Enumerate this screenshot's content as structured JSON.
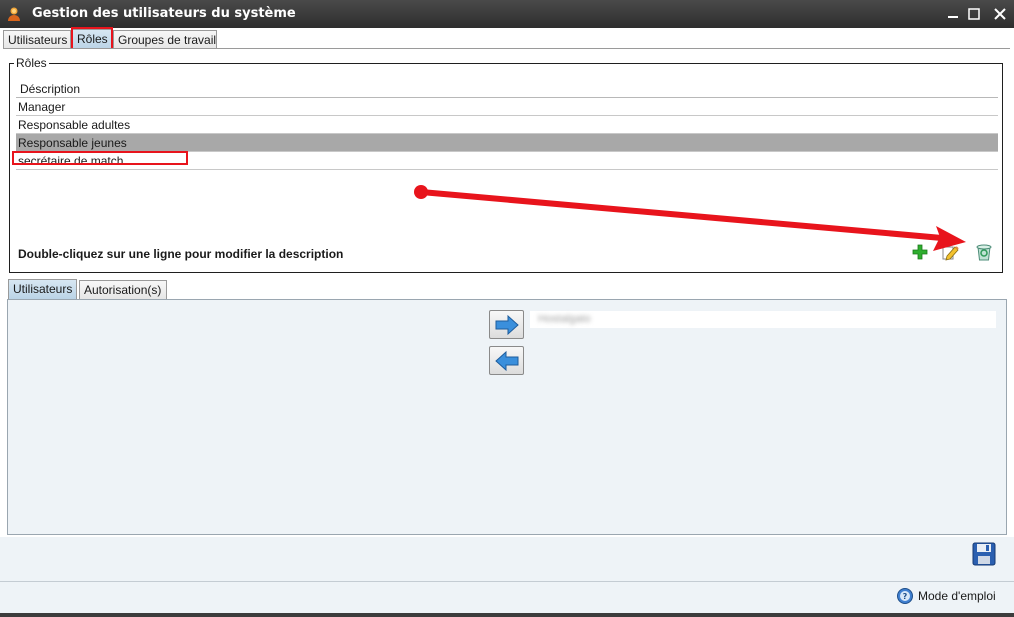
{
  "window": {
    "title": "Gestion des utilisateurs du système",
    "icon": "users-icon",
    "controls": [
      "minimize-icon",
      "maximize-icon",
      "close-icon"
    ]
  },
  "top_tabs": [
    {
      "label": "Utilisateurs",
      "active": false
    },
    {
      "label": "Rôles",
      "active": true
    },
    {
      "label": "Groupes de travail",
      "active": false
    }
  ],
  "roles": {
    "legend": "Rôles",
    "column_header": "Déscription",
    "rows": [
      {
        "label": "Manager",
        "selected": false
      },
      {
        "label": "Responsable adultes",
        "selected": false
      },
      {
        "label": "Responsable jeunes",
        "selected": true
      },
      {
        "label": "secrétaire de match",
        "selected": false
      }
    ],
    "hint": "Double-cliquez sur une ligne pour modifier la description",
    "actions": [
      "add-icon",
      "edit-icon",
      "delete-icon"
    ]
  },
  "bottom_tabs": [
    {
      "label": "Utilisateurs",
      "active": true
    },
    {
      "label": "Autorisation(s)",
      "active": false
    }
  ],
  "users_panel": {
    "buttons": [
      "arrow-right-icon",
      "arrow-left-icon"
    ],
    "assigned_users": [
      "Hostalgato"
    ]
  },
  "footer": {
    "save_icon": "save-icon",
    "help_label": "Mode d'emploi"
  },
  "colors": {
    "annotation_red": "#e8141c",
    "selected_row": "#a8a8a8",
    "active_tab": "#b9d3e6"
  }
}
